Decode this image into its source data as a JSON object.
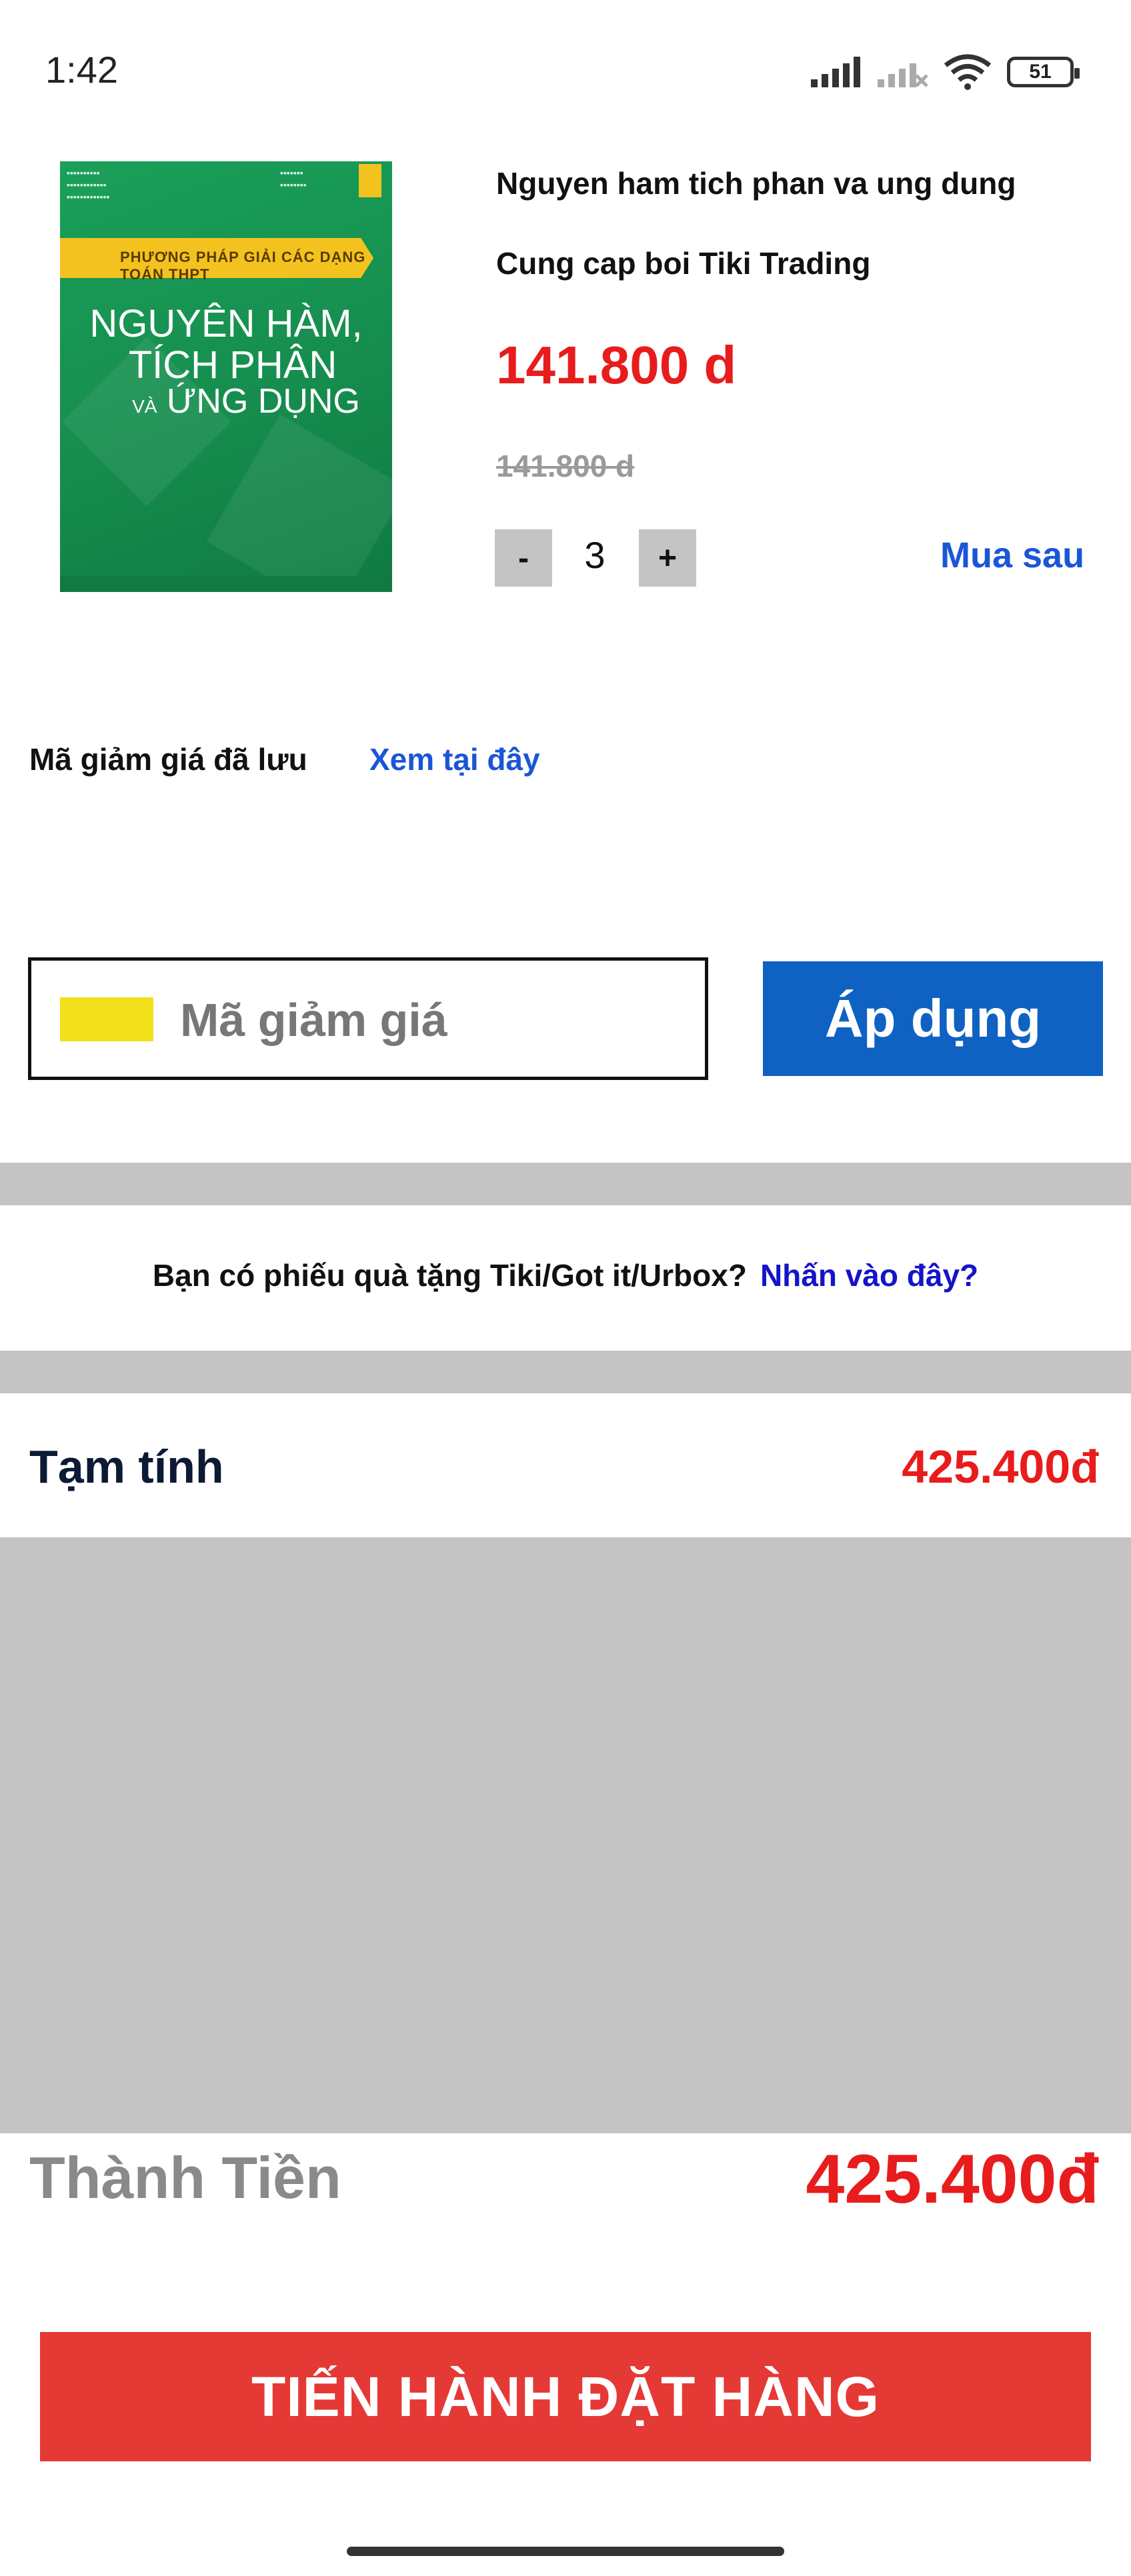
{
  "status_bar": {
    "time": "1:42",
    "battery": "51",
    "icons": [
      "signal-icon",
      "signal-off-icon",
      "wifi-icon",
      "battery-icon"
    ]
  },
  "product": {
    "cover": {
      "band_text": "PHƯƠNG PHÁP GIẢI CÁC DẠNG TOÁN THPT",
      "title_line1": "NGUYÊN HÀM,",
      "title_line2": "TÍCH PHÂN",
      "title_line3_prefix": "VÀ",
      "title_line3": "ỨNG DỤNG"
    },
    "name": "Nguyen ham tich phan va ung dung",
    "seller": "Cung cap boi Tiki Trading",
    "price": "141.800 d",
    "old_price": "141.800 d",
    "quantity": "3",
    "minus_label": "-",
    "plus_label": "+",
    "buy_later": "Mua sau"
  },
  "coupon": {
    "saved_label": "Mã giảm giá đã lưu",
    "saved_link": "Xem tại đây",
    "placeholder": "Mã giảm giá",
    "apply_label": "Áp dụng"
  },
  "gift": {
    "text": "Bạn có phiếu quà tặng Tiki/Got it/Urbox?",
    "link": "Nhấn vào đây?"
  },
  "summary": {
    "subtotal_label": "Tạm tính",
    "subtotal_value": "425.400đ",
    "total_label": "Thành Tiền",
    "total_value": "425.400đ"
  },
  "checkout": {
    "order_label": "TIẾN HÀNH ĐẶT HÀNG"
  },
  "colors": {
    "price_red": "#e81c1c",
    "link_blue": "#1a56d6",
    "apply_blue": "#0f62c2",
    "order_red": "#e53935",
    "divider_gray": "#c4c4c4",
    "coupon_chip_yellow": "#f2e01a"
  }
}
